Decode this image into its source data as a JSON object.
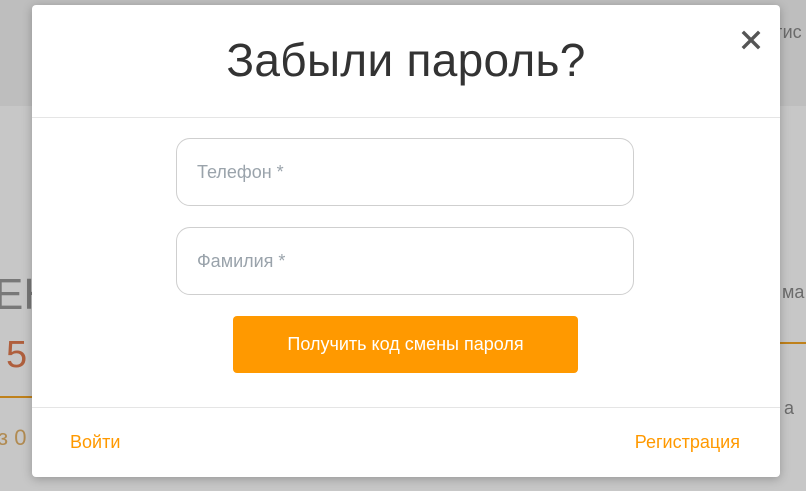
{
  "background": {
    "header_link": "гис",
    "big_letter": "ЕК",
    "price": "5",
    "small_text": "з 0",
    "right_text_1": "ма",
    "right_text_2": "а"
  },
  "modal": {
    "title": "Забыли пароль?",
    "close_icon": "close-icon",
    "fields": {
      "phone": {
        "placeholder": "Телефон *",
        "value": ""
      },
      "surname": {
        "placeholder": "Фамилия *",
        "value": ""
      }
    },
    "submit_label": "Получить код смены пароля",
    "footer": {
      "login_label": "Войти",
      "register_label": "Регистрация"
    }
  },
  "colors": {
    "accent": "#ff9900",
    "title": "#333333",
    "placeholder": "#9aa3ab",
    "border": "#cfcfcf"
  }
}
